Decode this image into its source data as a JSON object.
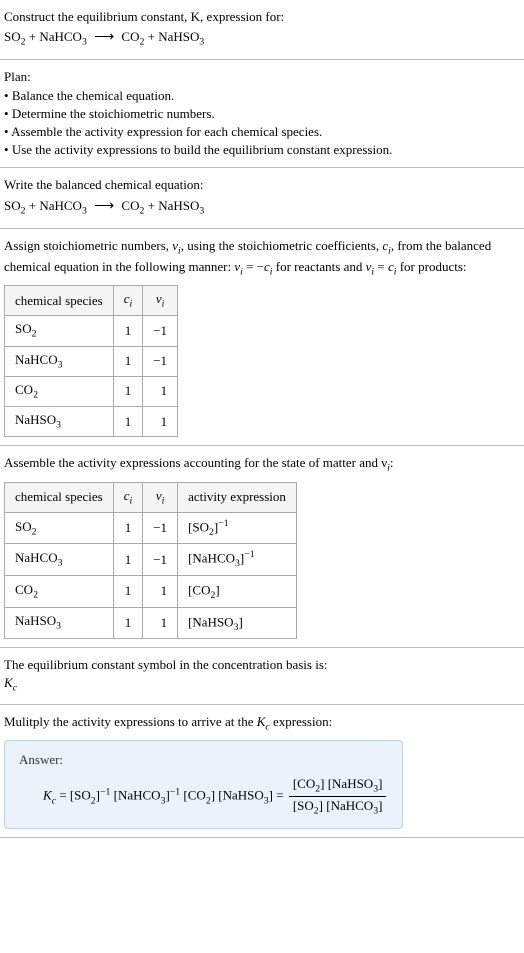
{
  "header": {
    "prompt": "Construct the equilibrium constant, K, expression for:",
    "equation_lhs_1": "SO",
    "equation_lhs_1_sub": "2",
    "plus": " + ",
    "equation_lhs_2": "NaHCO",
    "equation_lhs_2_sub": "3",
    "arrow": "⟶",
    "equation_rhs_1": "CO",
    "equation_rhs_1_sub": "2",
    "equation_rhs_2": "NaHSO",
    "equation_rhs_2_sub": "3"
  },
  "plan": {
    "title": "Plan:",
    "items": [
      "Balance the chemical equation.",
      "Determine the stoichiometric numbers.",
      "Assemble the activity expression for each chemical species.",
      "Use the activity expressions to build the equilibrium constant expression."
    ]
  },
  "balanced": {
    "title": "Write the balanced chemical equation:"
  },
  "stoich": {
    "intro_1": "Assign stoichiometric numbers, ",
    "nu_i": "ν",
    "nu_sub": "i",
    "intro_2": ", using the stoichiometric coefficients, ",
    "c_i": "c",
    "c_sub": "i",
    "intro_3": ", from the balanced chemical equation in the following manner: ",
    "rel1": " = −",
    "intro_4": " for reactants and ",
    "rel2": " = ",
    "intro_5": " for products:",
    "headers": [
      "chemical species",
      "c",
      "ν"
    ],
    "header_sub": "i",
    "rows": [
      {
        "species_base": "SO",
        "species_sub": "2",
        "c": "1",
        "nu": "−1"
      },
      {
        "species_base": "NaHCO",
        "species_sub": "3",
        "c": "1",
        "nu": "−1"
      },
      {
        "species_base": "CO",
        "species_sub": "2",
        "c": "1",
        "nu": "1"
      },
      {
        "species_base": "NaHSO",
        "species_sub": "3",
        "c": "1",
        "nu": "1"
      }
    ]
  },
  "activity": {
    "title": "Assemble the activity expressions accounting for the state of matter and ν",
    "title_sub": "i",
    "title_end": ":",
    "headers": [
      "chemical species",
      "c",
      "ν",
      "activity expression"
    ],
    "header_sub": "i",
    "rows": [
      {
        "species_base": "SO",
        "species_sub": "2",
        "c": "1",
        "nu": "−1",
        "expr_base": "[SO",
        "expr_sub": "2",
        "expr_close": "]",
        "expr_sup": "−1"
      },
      {
        "species_base": "NaHCO",
        "species_sub": "3",
        "c": "1",
        "nu": "−1",
        "expr_base": "[NaHCO",
        "expr_sub": "3",
        "expr_close": "]",
        "expr_sup": "−1"
      },
      {
        "species_base": "CO",
        "species_sub": "2",
        "c": "1",
        "nu": "1",
        "expr_base": "[CO",
        "expr_sub": "2",
        "expr_close": "]",
        "expr_sup": ""
      },
      {
        "species_base": "NaHSO",
        "species_sub": "3",
        "c": "1",
        "nu": "1",
        "expr_base": "[NaHSO",
        "expr_sub": "3",
        "expr_close": "]",
        "expr_sup": ""
      }
    ]
  },
  "symbol": {
    "line1": "The equilibrium constant symbol in the concentration basis is:",
    "Kc_base": "K",
    "Kc_sub": "c"
  },
  "multiply": {
    "text_1": "Mulitply the activity expressions to arrive at the ",
    "Kc_base": "K",
    "Kc_sub": "c",
    "text_2": " expression:"
  },
  "answer": {
    "label": "Answer:",
    "Kc_base": "K",
    "Kc_sub": "c",
    "eq": " = ",
    "t1": "[SO",
    "t1s": "2",
    "t1c": "]",
    "t1sup": "−1",
    "sp": " ",
    "t2": "[NaHCO",
    "t2s": "3",
    "t2c": "]",
    "t2sup": "−1",
    "t3": "[CO",
    "t3s": "2",
    "t3c": "]",
    "t4": "[NaHSO",
    "t4s": "3",
    "t4c": "]",
    "eq2": " = ",
    "num1": "[CO",
    "num1s": "2",
    "num1c": "] ",
    "num2": "[NaHSO",
    "num2s": "3",
    "num2c": "]",
    "den1": "[SO",
    "den1s": "2",
    "den1c": "] ",
    "den2": "[NaHCO",
    "den2s": "3",
    "den2c": "]"
  }
}
